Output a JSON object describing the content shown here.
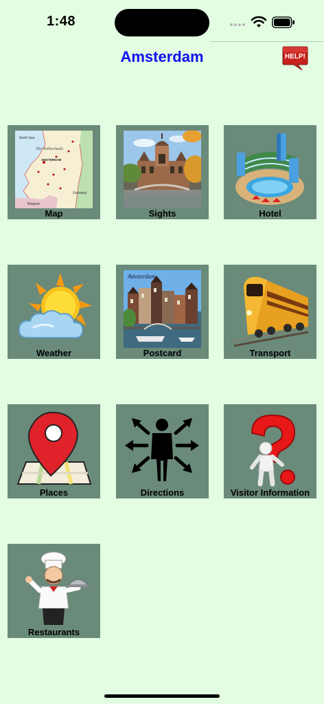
{
  "status_bar": {
    "time": "1:48"
  },
  "header": {
    "title": "Amsterdam",
    "help_label": "HELP!"
  },
  "tiles": [
    {
      "label": "Map",
      "icon": "map-icon"
    },
    {
      "label": "Sights",
      "icon": "sights-icon"
    },
    {
      "label": "Hotel",
      "icon": "hotel-icon"
    },
    {
      "label": "Weather",
      "icon": "weather-icon"
    },
    {
      "label": "Postcard",
      "icon": "postcard-icon"
    },
    {
      "label": "Transport",
      "icon": "train-icon"
    },
    {
      "label": "Places",
      "icon": "location-pin-icon"
    },
    {
      "label": "Directions",
      "icon": "directions-icon"
    },
    {
      "label": "Visitor Information",
      "icon": "question-icon"
    },
    {
      "label": "Restaurants",
      "icon": "chef-icon"
    }
  ],
  "map_art": {
    "sea": "North Sea",
    "country": "The Netherlands",
    "capital": "AMSTERDAM",
    "neighbor_east": "Germany",
    "neighbor_south": "Belgium"
  },
  "postcard_art": {
    "caption": "Amsterdam"
  },
  "colors": {
    "background": "#e2fde2",
    "tile": "#6a8a7a",
    "title": "#1010f0",
    "help": "#c8221e"
  }
}
